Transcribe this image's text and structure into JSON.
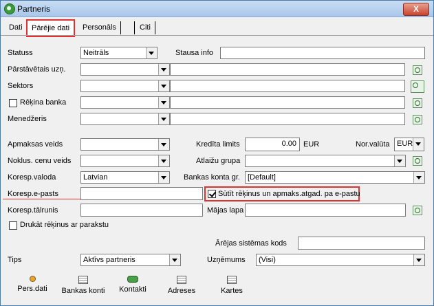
{
  "window": {
    "title": "Partneris",
    "close_label": "X"
  },
  "tabs": [
    "Dati",
    "Pārējie dati",
    "Personāls",
    "",
    "Citi"
  ],
  "form": {
    "statuss_label": "Statuss",
    "statuss_value": "Neitrāls",
    "stausa_info_label": "Stausa info",
    "stausa_info_value": "",
    "parstavetais_label": "Pārstāvētais uzņ.",
    "sektors_label": "Sektors",
    "rekina_banka_label": "Rēķina banka",
    "menedzeris_label": "Menedžeris",
    "apmaksas_veids_label": "Apmaksas veids",
    "kredita_limits_label": "Kredīta limits",
    "kredita_limits_value": "0.00",
    "currency_label": "EUR",
    "nor_valuta_label": "Nor.valūta",
    "nor_valuta_value": "EUR",
    "noklus_cenu_label": "Noklus. cenu veids",
    "atlaizu_grupa_label": "Atlaižu grupa",
    "koresp_valoda_label": "Koresp.valoda",
    "koresp_valoda_value": "Latvian",
    "bankas_konta_label": "Bankas konta gr.",
    "bankas_konta_value": "[Default]",
    "koresp_epasts_label": "Koresp.e-pasts",
    "sutit_label": "Sūtīt rēķinus un apmaks.atgad. pa e-pastu",
    "koresp_talrunis_label": "Koresp.tālrunis",
    "majas_lapa_label": "Mājas lapa",
    "drukat_label": "Drukāt rēķinus ar parakstu",
    "arejas_label": "Ārējas sistēmas kods",
    "tips_label": "Tips",
    "tips_value": "Aktīvs partneris",
    "uznemums_label": "Uzņēmums",
    "uznemums_value": "(Visi)"
  },
  "buttons": {
    "pers_dati": "Pers.dati",
    "bankas_konti": "Bankas konti",
    "kontakti": "Kontakti",
    "adreses": "Adreses",
    "kartes": "Kartes"
  }
}
